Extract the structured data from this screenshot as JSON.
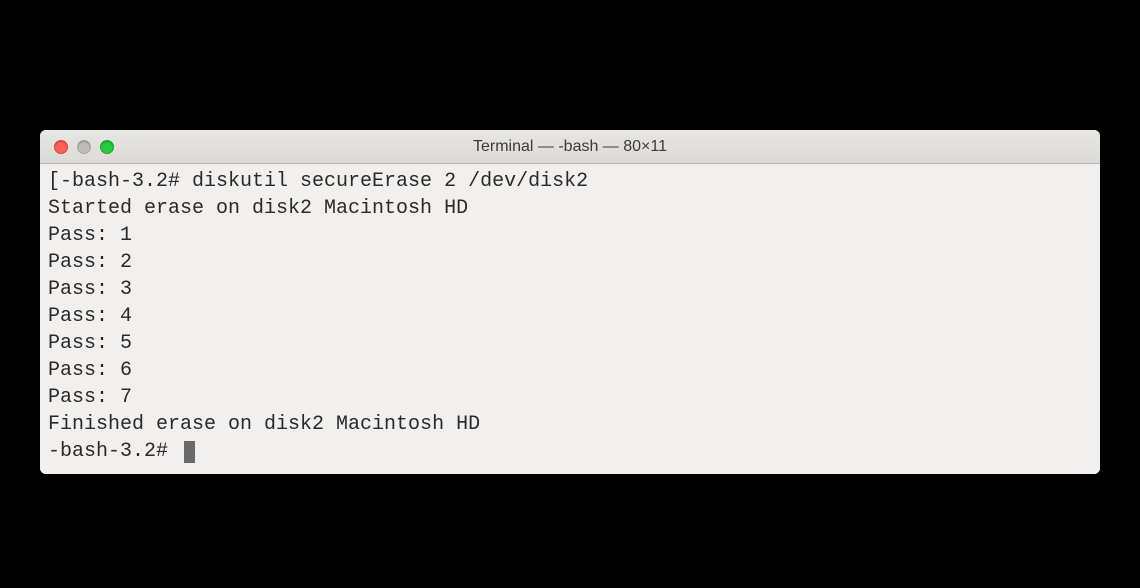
{
  "window": {
    "title": "Terminal — -bash — 80×11"
  },
  "terminal": {
    "lines": [
      "[-bash-3.2# diskutil secureErase 2 /dev/disk2",
      "Started erase on disk2 Macintosh HD",
      "Pass: 1",
      "Pass: 2",
      "Pass: 3",
      "Pass: 4",
      "Pass: 5",
      "Pass: 6",
      "Pass: 7",
      "Finished erase on disk2 Macintosh HD"
    ],
    "prompt": "-bash-3.2# "
  }
}
